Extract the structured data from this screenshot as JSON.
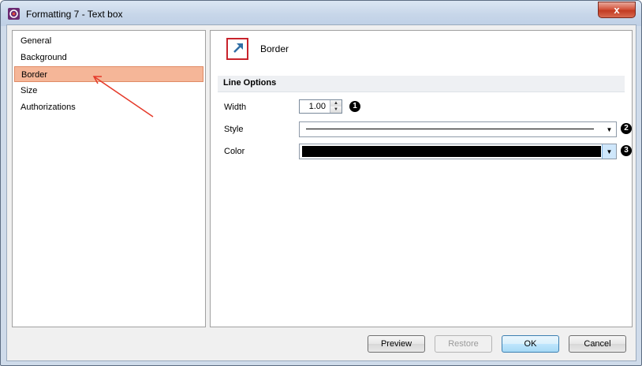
{
  "window": {
    "title": "Formatting 7 - Text box",
    "close_label": "x"
  },
  "nav": {
    "items": [
      {
        "label": "General",
        "selected": false
      },
      {
        "label": "Background",
        "selected": false
      },
      {
        "label": "Border",
        "selected": true
      },
      {
        "label": "Size",
        "selected": false
      },
      {
        "label": "Authorizations",
        "selected": false
      }
    ],
    "annotation_color": "#e53a2a"
  },
  "content": {
    "heading": "Border",
    "section": "Line Options",
    "width": {
      "label": "Width",
      "value": "1.00",
      "badge": "1"
    },
    "style": {
      "label": "Style",
      "badge": "2"
    },
    "color": {
      "label": "Color",
      "value_color": "#000000",
      "badge": "3"
    }
  },
  "buttons": {
    "preview": "Preview",
    "restore": "Restore",
    "ok": "OK",
    "cancel": "Cancel"
  },
  "colors": {
    "selection": "#f5b698",
    "accent_red": "#c8232c",
    "icon_arrow": "#2f6ea5"
  }
}
